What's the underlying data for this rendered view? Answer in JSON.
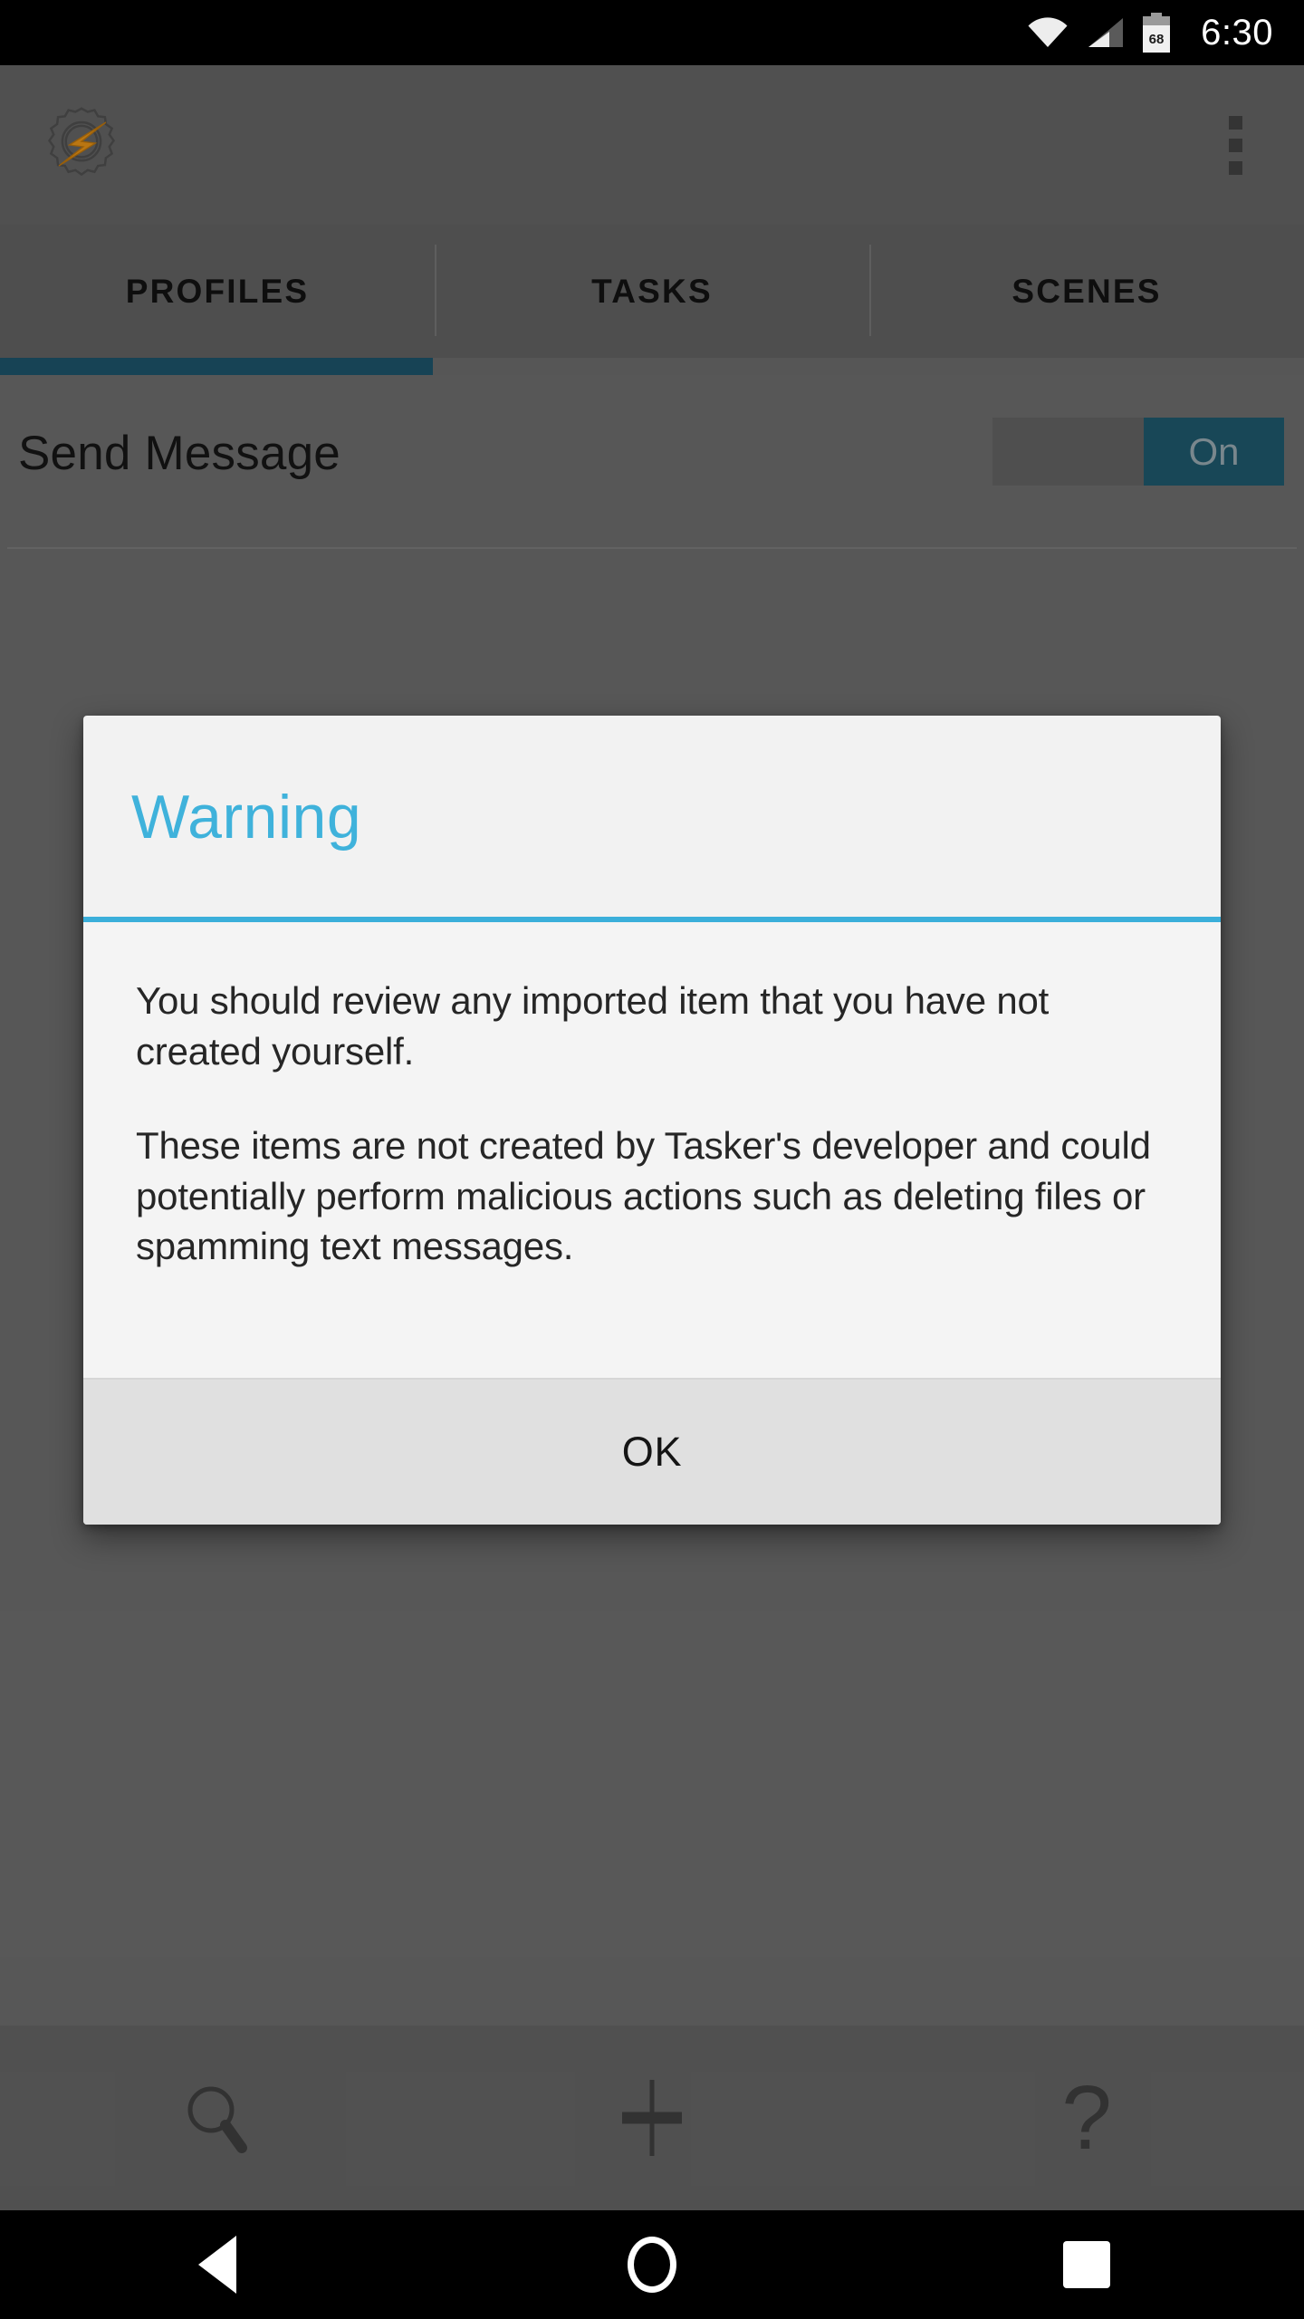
{
  "status_bar": {
    "time": "6:30",
    "battery_level": "68",
    "wifi_icon": "wifi-icon",
    "signal_icon": "cellular-signal-icon",
    "battery_icon": "battery-icon"
  },
  "app_bar": {
    "logo_icon": "tasker-gear-bolt-logo",
    "overflow_icon": "overflow-menu-icon"
  },
  "tabs": {
    "items": [
      {
        "label": "PROFILES",
        "selected": true
      },
      {
        "label": "TASKS",
        "selected": false
      },
      {
        "label": "SCENES",
        "selected": false
      }
    ],
    "indicator_color": "#1B4F63"
  },
  "list": {
    "rows": [
      {
        "title": "Send Message",
        "toggle_label": "On",
        "toggle_state": "on",
        "toggle_on_color": "#1D5366"
      }
    ]
  },
  "bottom_bar": {
    "search_icon": "search-icon",
    "add_icon": "plus-icon",
    "help_icon": "help-question-mark-icon",
    "help_glyph": "?"
  },
  "nav_bar": {
    "back_icon": "back-triangle-icon",
    "home_icon": "home-circle-icon",
    "recents_icon": "recents-square-icon"
  },
  "dialog": {
    "title": "Warning",
    "title_color": "#3FB2DB",
    "rule_color": "#3BAFDA",
    "paragraphs": [
      "You should review any imported item that you have not created yourself.",
      "These items are not created by Tasker's developer and could potentially perform malicious actions such as deleting files or spamming text messages."
    ],
    "ok_label": "OK"
  }
}
